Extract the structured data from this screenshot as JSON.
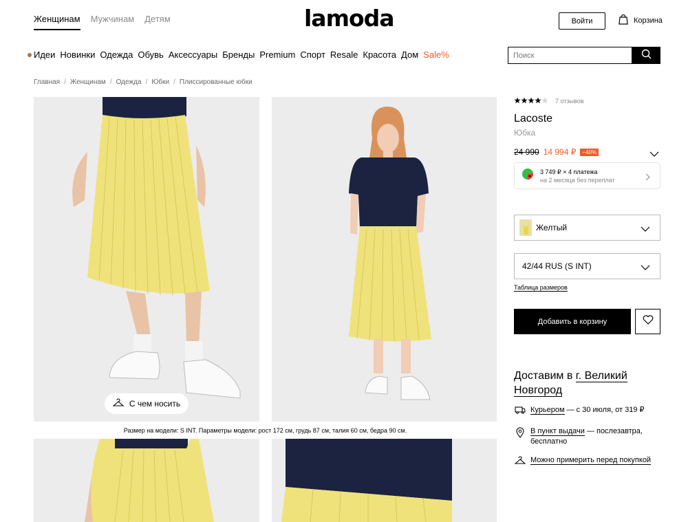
{
  "header": {
    "gender_tabs": [
      "Женщинам",
      "Мужчинам",
      "Детям"
    ],
    "logo": "lamoda",
    "login_label": "Войти",
    "cart_label": "Корзина"
  },
  "nav": {
    "items": [
      "Идеи",
      "Новинки",
      "Одежда",
      "Обувь",
      "Аксессуары",
      "Бренды",
      "Premium",
      "Спорт",
      "Resale",
      "Красота",
      "Дом"
    ],
    "sale": "Sale%",
    "search_placeholder": "Поиск"
  },
  "breadcrumbs": [
    "Главная",
    "Женщинам",
    "Одежда",
    "Юбки",
    "Плиссированные юбки"
  ],
  "gallery": {
    "wear_button": "С чем носить",
    "model_note": "Размер на модели: S INT. Параметры модели: рост 172 см, грудь 87 см, талия 60 см, бедра 90 см."
  },
  "product": {
    "rating": 4,
    "reviews": "7 отзывов",
    "brand": "Lacoste",
    "type": "Юбка",
    "old_price": "24 990",
    "new_price": "14 994 ₽",
    "discount": "−40%",
    "split_title": "3 749 ₽ × 4 платежа",
    "split_sub": "на 2 месяца без переплат",
    "color": "Желтый",
    "size": "42/44 RUS (S INT)",
    "size_table": "Таблица размеров",
    "add_to_cart": "Добавить в корзину"
  },
  "delivery": {
    "title_prefix": "Доставим в",
    "city": "г. Великий Новгород",
    "courier_link": "Курьером",
    "courier_rest": " — с 30 июля, от 319 ₽",
    "pickup_link": "В пункт выдачи",
    "pickup_rest": " — послезавтра, бесплатно",
    "fitting_link": "Можно примерить перед покупкой"
  },
  "colors": {
    "accent": "#f05a28",
    "skirt": "#f0e27a",
    "polo": "#1c2340"
  }
}
